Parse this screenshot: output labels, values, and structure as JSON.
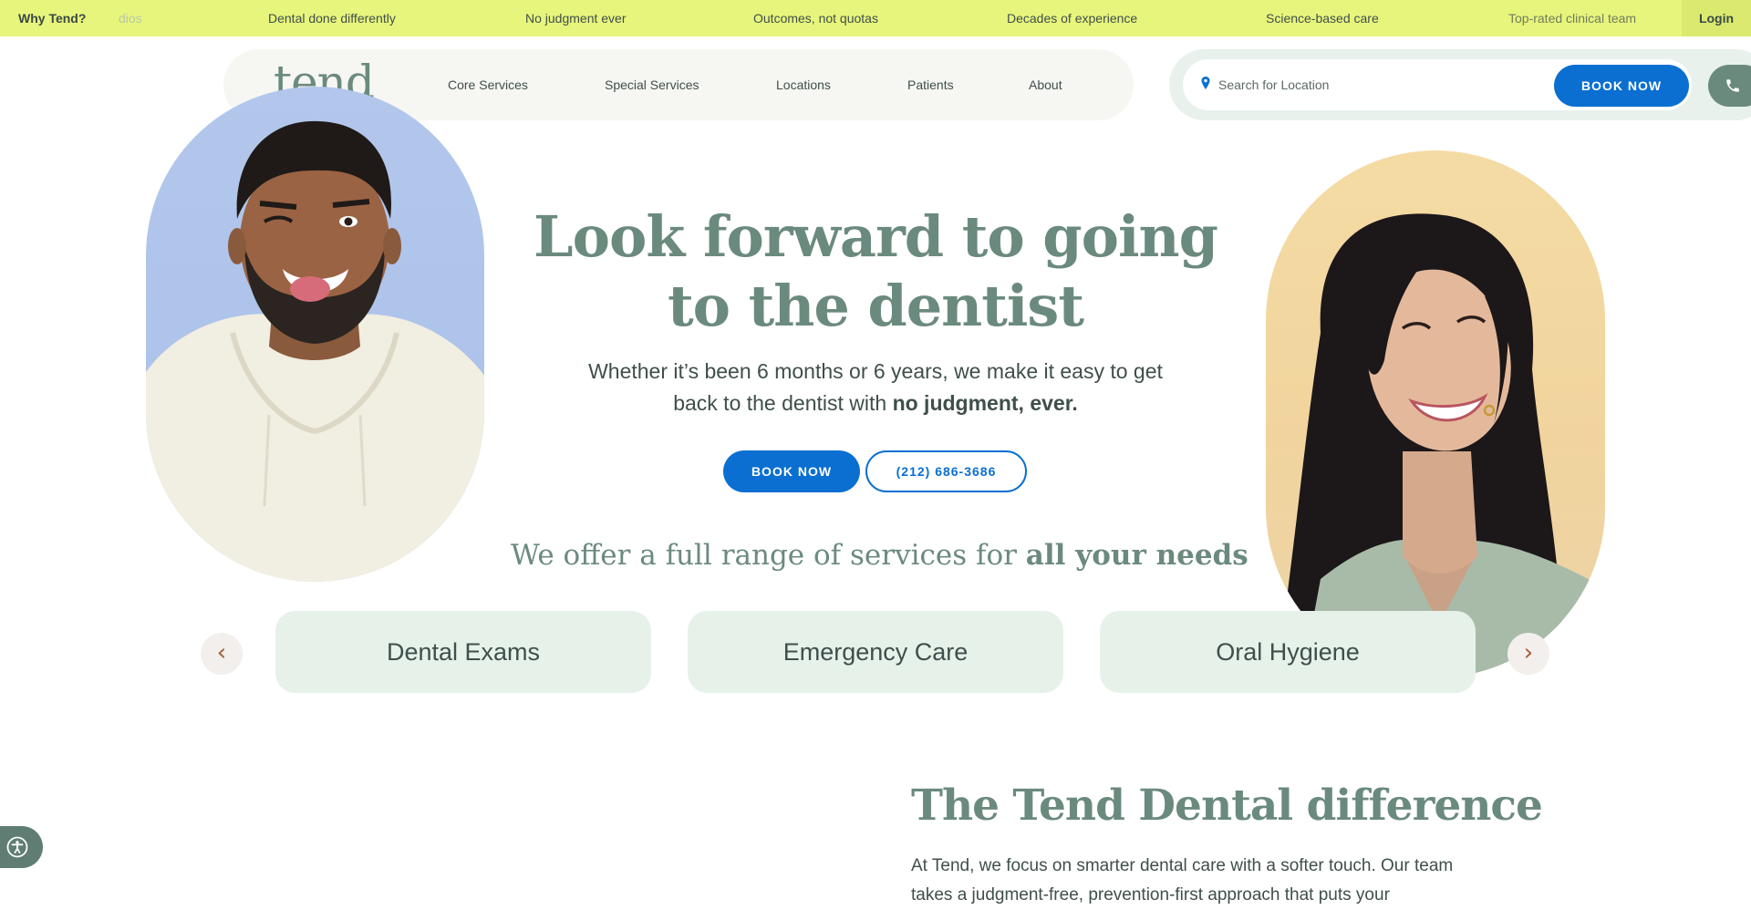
{
  "announcement_bar": {
    "why_label": "Why Tend?",
    "faded_item": "dios",
    "items": [
      "Dental done differently",
      "No judgment ever",
      "Outcomes, not quotas",
      "Decades of experience",
      "Science-based care",
      "Top-rated clinical team"
    ],
    "login_label": "Login"
  },
  "header": {
    "logo_text": "tend",
    "nav": [
      "Core Services",
      "Special Services",
      "Locations",
      "Patients",
      "About"
    ],
    "search_placeholder": "Search for Location",
    "book_label": "BOOK NOW",
    "phone_icon": "phone-icon"
  },
  "hero": {
    "title_line1": "Look forward to going",
    "title_line2": "to the dentist",
    "subtitle_prefix": "Whether it’s been 6 months or 6 years, we make it easy to get back to the dentist with ",
    "subtitle_bold": "no judgment, ever.",
    "book_label": "BOOK NOW",
    "phone_label": "(212) 686-3686"
  },
  "services": {
    "heading_prefix": "We offer a full range of services for ",
    "heading_bold": "all your needs",
    "prev_label": "‹",
    "next_label": "›",
    "cards": [
      "Dental Exams",
      "Emergency Care",
      "Oral Hygiene"
    ]
  },
  "difference": {
    "title": "The Tend Dental difference",
    "body": "At Tend, we focus on smarter dental care with a softer touch. Our team takes a judgment-free, prevention-first approach that puts your"
  },
  "colors": {
    "announcement_bg": "#e8f57c",
    "brand_green": "#6b8a7e",
    "primary_blue": "#0a6fd1",
    "card_bg": "#e6f1ea"
  }
}
